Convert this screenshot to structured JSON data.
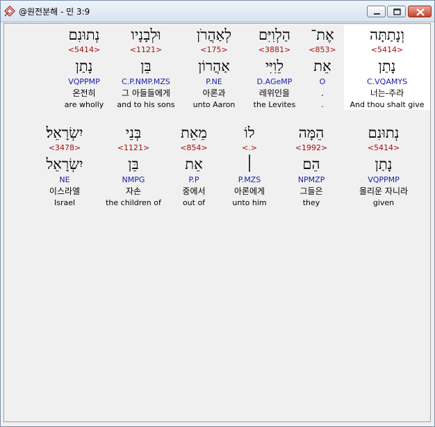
{
  "window": {
    "title": "@원전분해 - 민 3:9"
  },
  "rows": [
    [
      {
        "hebrew": "וְנָתַתָּה",
        "strong": "<5414>",
        "lemma": "נָתַן",
        "morph": "C.VQAMYS",
        "korean": "너는-주라",
        "english": "And thou shalt give",
        "highlight": true
      },
      {
        "hebrew": "אֶת־",
        "strong": "<853>",
        "lemma": "אֵת",
        "morph": "O",
        "korean": ".",
        "english": "."
      },
      {
        "hebrew": "הַלְוִיִּם",
        "strong": "<3881>",
        "lemma": "לֵוִיִּי",
        "morph": "D.AGeMP",
        "korean": "레위인을",
        "english": "the Levites"
      },
      {
        "hebrew": "לְאַהֲרֹן",
        "strong": "<175>",
        "lemma": "אַהֲרוֹן",
        "morph": "P.NE",
        "korean": "아론과",
        "english": "unto Aaron"
      },
      {
        "hebrew": "וּלְבָנָיו",
        "strong": "<1121>",
        "lemma": "בֵּן",
        "morph": "C.P.NMP.MZS",
        "korean": "그 아들들에게",
        "english": "and to his sons"
      },
      {
        "hebrew": "נְתוּנִם",
        "strong": "<5414>",
        "lemma": "נָתַן",
        "morph": "VQPPMP",
        "korean": "온전히",
        "english": "are wholly"
      }
    ],
    [
      {
        "hebrew": "נְתוּנִם",
        "strong": "<5414>",
        "lemma": "נָתַן",
        "morph": "VQPPMP",
        "korean": "올리운 자니라",
        "english": "given"
      },
      {
        "hebrew": "הֵמָּה",
        "strong": "<1992>",
        "lemma": "הֵם",
        "morph": "NPMZP",
        "korean": "그들은",
        "english": "they"
      },
      {
        "hebrew": "לוֹ",
        "strong": "<.>",
        "lemma": "׀",
        "morph": "P.MZS",
        "korean": "아론에게",
        "english": "unto him"
      },
      {
        "hebrew": "מֵאֵת",
        "strong": "<854>",
        "lemma": "אֵת",
        "morph": "P.P",
        "korean": "중에서",
        "english": "out of"
      },
      {
        "hebrew": "בְּנֵי",
        "strong": "<1121>",
        "lemma": "בֵּן",
        "morph": "NMPG",
        "korean": "자손",
        "english": "the children of"
      },
      {
        "hebrew": "יִשְׂרָאֵל׃",
        "strong": "<3478>",
        "lemma": "יִשְׂרָאֵל",
        "morph": "NE",
        "korean": "이스라엘",
        "english": "Israel"
      }
    ]
  ]
}
